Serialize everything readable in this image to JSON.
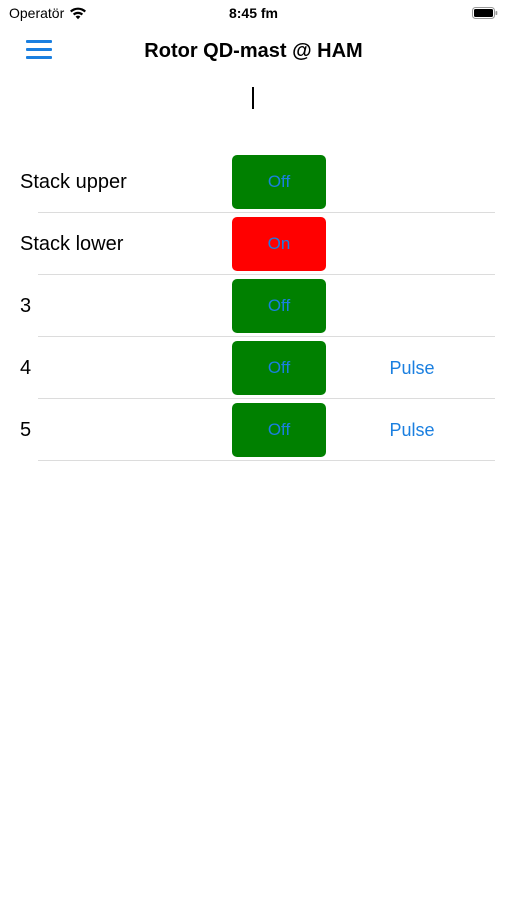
{
  "status_bar": {
    "carrier": "Operatör",
    "time": "8:45 fm",
    "wifi_icon": "wifi-icon",
    "battery_icon": "battery-icon"
  },
  "nav": {
    "title": "Rotor QD-mast @ HAM",
    "menu_icon": "hamburger-menu-icon"
  },
  "colors": {
    "accent": "#1a7fe0",
    "off": "#008000",
    "on": "#ff0000",
    "separator": "#dcdcdc"
  },
  "rows": [
    {
      "label": "Stack upper",
      "state": "off",
      "button_label": "Off",
      "pulse_label": ""
    },
    {
      "label": "Stack lower",
      "state": "on",
      "button_label": "On",
      "pulse_label": ""
    },
    {
      "label": "3",
      "state": "off",
      "button_label": "Off",
      "pulse_label": ""
    },
    {
      "label": "4",
      "state": "off",
      "button_label": "Off",
      "pulse_label": "Pulse"
    },
    {
      "label": "5",
      "state": "off",
      "button_label": "Off",
      "pulse_label": "Pulse"
    }
  ]
}
